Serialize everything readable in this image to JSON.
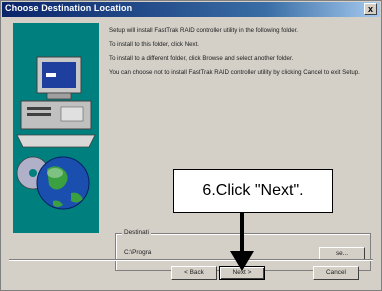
{
  "window": {
    "title": "Choose Destination Location",
    "close_label": "x"
  },
  "text": {
    "p1": "Setup will install FastTrak RAID controller utility in the following folder.",
    "p2": "To install to this folder, click Next.",
    "p3": "To install to a different folder, click Browse and select another folder.",
    "p4": "You can choose not to install FastTrak RAID controller utility by clicking Cancel to exit Setup."
  },
  "destination": {
    "label": "Destinati",
    "path": "C:\\Progra"
  },
  "buttons": {
    "browse": "se...",
    "back": "< Back",
    "next": "Next >",
    "cancel": "Cancel"
  },
  "callout": {
    "text": "6.Click \"Next\"."
  },
  "colors": {
    "title_start": "#0a246a",
    "title_end": "#a6caf0",
    "dialog_bg": "#d4d0c8",
    "art_bg": "#007f7f"
  }
}
